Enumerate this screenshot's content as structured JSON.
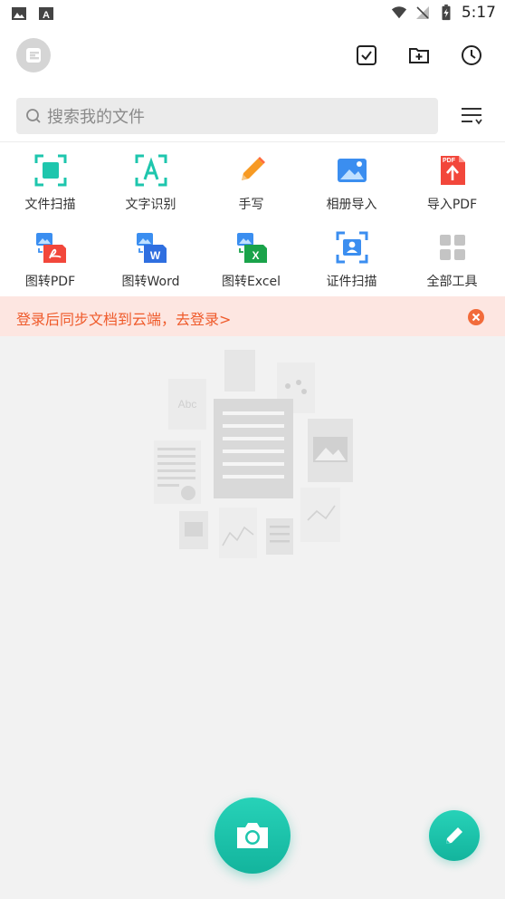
{
  "status_bar": {
    "time": "5:17"
  },
  "header": {
    "icons": [
      "user-avatar-icon",
      "check-square-icon",
      "add-folder-icon",
      "history-clock-icon"
    ]
  },
  "search": {
    "placeholder": "搜索我的文件"
  },
  "tools": [
    {
      "label": "文件扫描",
      "icon": "document-scan-icon"
    },
    {
      "label": "文字识别",
      "icon": "text-recognition-icon"
    },
    {
      "label": "手写",
      "icon": "pencil-icon"
    },
    {
      "label": "相册导入",
      "icon": "album-import-icon"
    },
    {
      "label": "导入PDF",
      "icon": "pdf-import-icon",
      "badge": "PDF"
    },
    {
      "label": "图转PDF",
      "icon": "image-to-pdf-icon"
    },
    {
      "label": "图转Word",
      "icon": "image-to-word-icon",
      "badge": "W"
    },
    {
      "label": "图转Excel",
      "icon": "image-to-excel-icon",
      "badge": "X"
    },
    {
      "label": "证件扫描",
      "icon": "id-card-scan-icon"
    },
    {
      "label": "全部工具",
      "icon": "grid-tools-icon"
    }
  ],
  "banner": {
    "text": "登录后同步文档到云端，去登录>"
  },
  "empty_state": {
    "abc_text": "Abc"
  },
  "colors": {
    "accent": "#1ec6ad",
    "banner_bg": "#fde6e1",
    "banner_text": "#ef5a2a",
    "banner_close": "#f26b3a"
  }
}
